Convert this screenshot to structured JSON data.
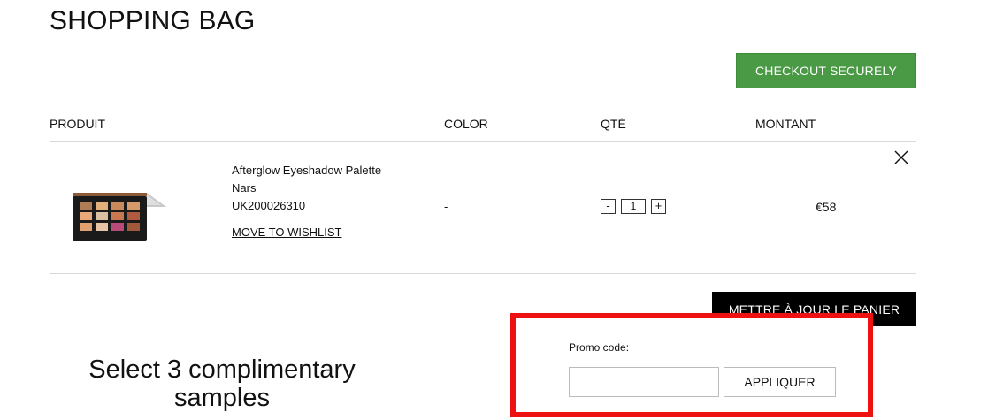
{
  "page": {
    "title": "SHOPPING BAG"
  },
  "actions": {
    "checkout_label": "CHECKOUT SECURELY",
    "update_cart_label": "METTRE À JOUR LE PANIER"
  },
  "table": {
    "headers": [
      "PRODUIT",
      "COLOR",
      "QTÉ",
      "MONTANT"
    ]
  },
  "cart_items": [
    {
      "name": "Afterglow Eyeshadow Palette",
      "brand": "Nars",
      "sku": "UK200026310",
      "wishlist_label": "MOVE TO WISHLIST",
      "color": "-",
      "qty_minus": "-",
      "qty": "1",
      "qty_plus": "+",
      "amount": "€58",
      "remove_icon": "close-icon"
    }
  ],
  "promo": {
    "label": "Promo code:",
    "value": "",
    "apply_label": "APPLIQUER",
    "highlight_color": "#ee1111"
  },
  "samples": {
    "heading": "Select 3 complimentary samples"
  },
  "colors": {
    "checkout_bg": "#4a9a45",
    "update_bg": "#000000"
  }
}
